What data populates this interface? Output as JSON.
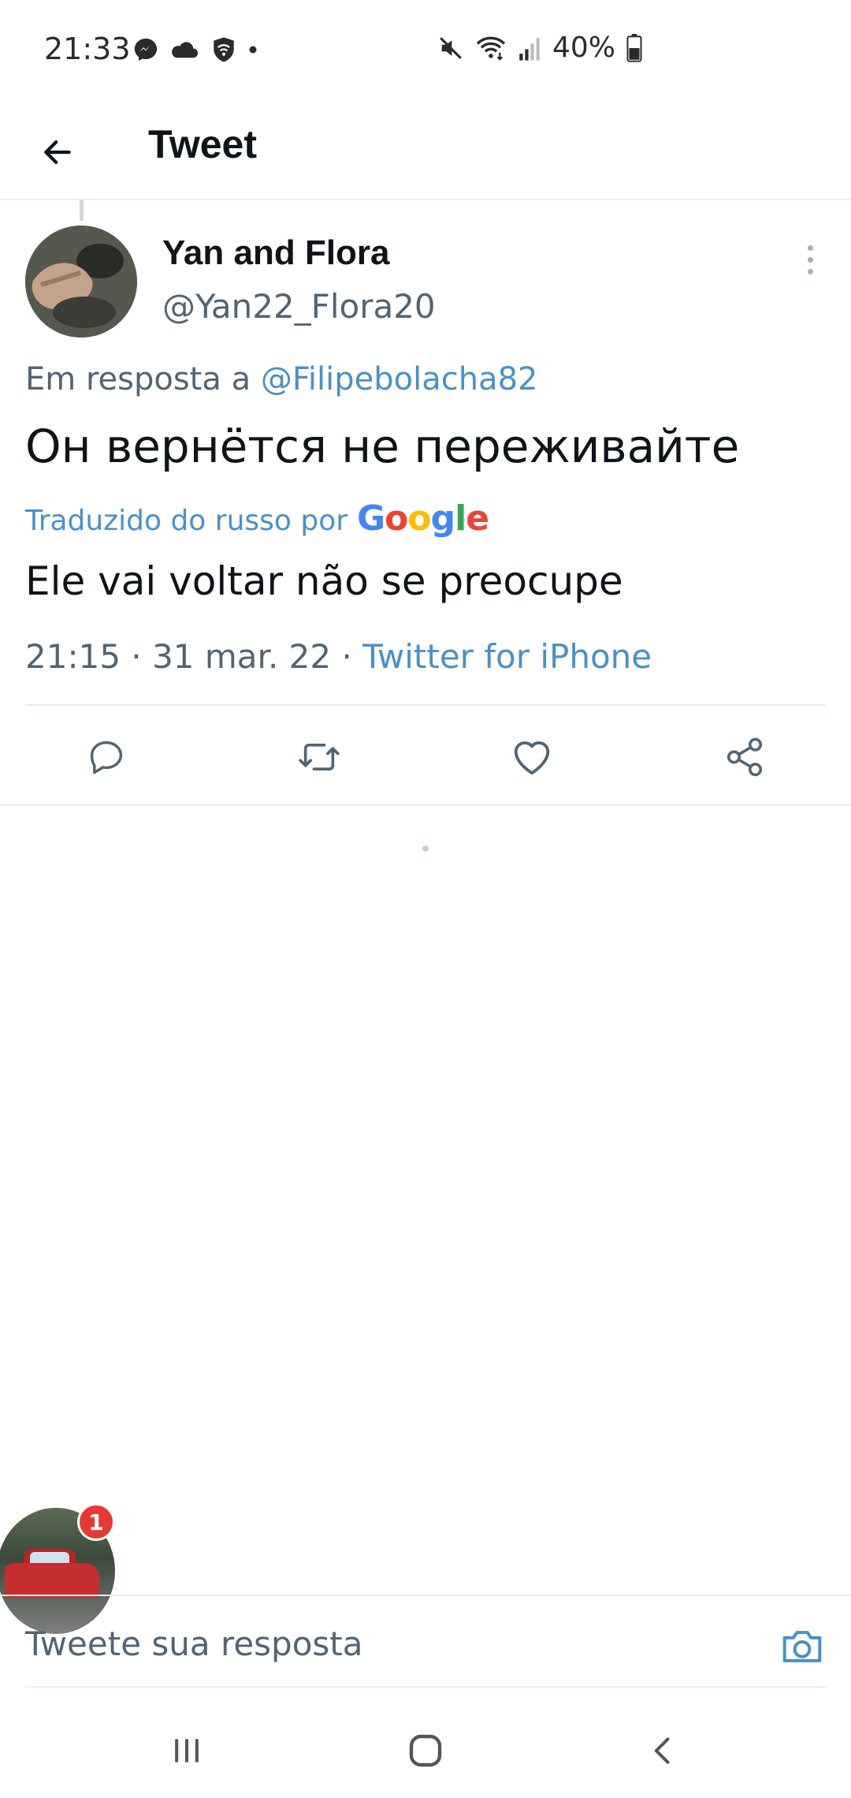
{
  "status_bar": {
    "time": "21:33",
    "battery": "40%",
    "left_icons": [
      "messenger-icon",
      "cloud-icon",
      "shield-icon",
      "dot-icon"
    ],
    "right_icons": [
      "mute-icon",
      "wifi-icon",
      "signal-icon",
      "battery-icon"
    ]
  },
  "header": {
    "title": "Tweet"
  },
  "tweet": {
    "author_name": "Yan and Flora",
    "author_handle": "@Yan22_Flora20",
    "reply_prefix": "Em resposta a",
    "reply_mention": "@Filipebolacha82",
    "text": "Он вернётся не переживайте",
    "translated_label": "Traduzido do russo por",
    "translator": "Google",
    "translated_text": "Ele vai voltar não se preocupe",
    "timestamp": "21:15 · 31 mar. 22 · ",
    "source": "Twitter for iPhone"
  },
  "actions": [
    "reply-icon",
    "retweet-icon",
    "like-icon",
    "share-icon"
  ],
  "chat_head": {
    "badge_count": "1"
  },
  "composer": {
    "placeholder": "Tweete sua resposta"
  },
  "colors": {
    "link": "#4a90c8",
    "text": "#0f1419",
    "secondary": "#536471",
    "divider": "#e6ecf0",
    "badge": "#e53935"
  }
}
